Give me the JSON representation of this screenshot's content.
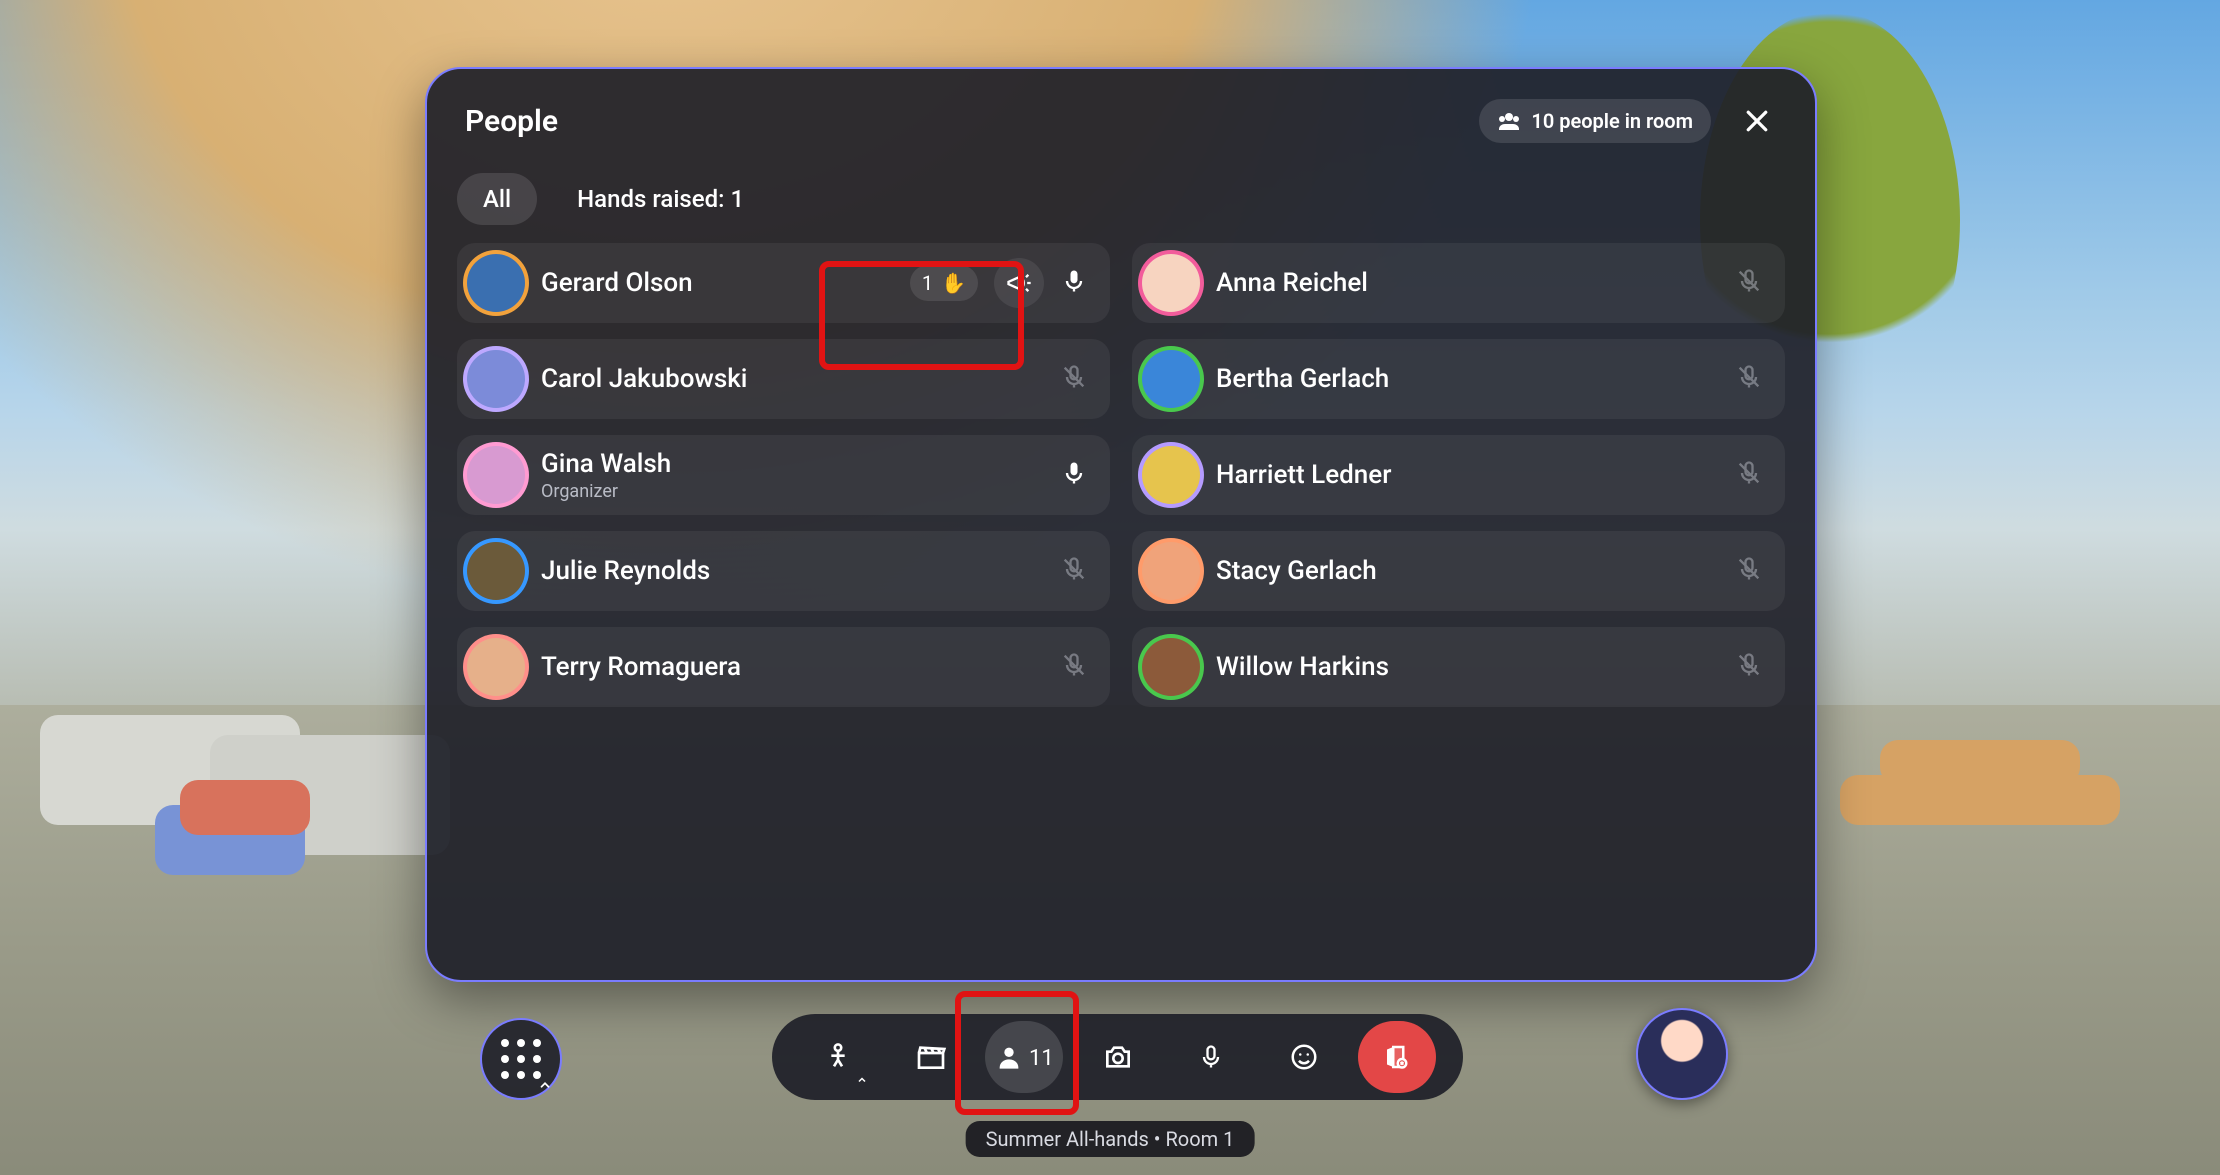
{
  "panel": {
    "title": "People",
    "room_badge": "10 people in room",
    "tabs": {
      "all": "All",
      "raised": "Hands raised: 1"
    }
  },
  "people_left": [
    {
      "name": "Gerard Olson",
      "avatar_ring": "#f2a23c",
      "avatar_bg": "#3a6fb0",
      "hand_order": "1",
      "megaphone": true,
      "mic": "on"
    },
    {
      "name": "Carol Jakubowski",
      "avatar_ring": "#bda8ff",
      "avatar_bg": "#7c8bd9",
      "mic": "muted"
    },
    {
      "name": "Gina Walsh",
      "avatar_ring": "#ff9bd2",
      "avatar_bg": "#d89ad1",
      "role": "Organizer",
      "mic": "on"
    },
    {
      "name": "Julie Reynolds",
      "avatar_ring": "#3698ff",
      "avatar_bg": "#6b5a3a",
      "mic": "muted"
    },
    {
      "name": "Terry Romaguera",
      "avatar_ring": "#ff8f8a",
      "avatar_bg": "#e6b08a",
      "mic": "muted"
    }
  ],
  "people_right": [
    {
      "name": "Anna Reichel",
      "avatar_ring": "#f25c9b",
      "avatar_bg": "#f7d4c0",
      "mic": "muted"
    },
    {
      "name": "Bertha Gerlach",
      "avatar_ring": "#49c84d",
      "avatar_bg": "#3a86d9",
      "mic": "muted"
    },
    {
      "name": "Harriett Ledner",
      "avatar_ring": "#b59bff",
      "avatar_bg": "#e6c44d",
      "mic": "muted"
    },
    {
      "name": "Stacy Gerlach",
      "avatar_ring": "#ff9b6a",
      "avatar_bg": "#f0a37a",
      "mic": "muted"
    },
    {
      "name": "Willow Harkins",
      "avatar_ring": "#49c84d",
      "avatar_bg": "#8c5a3a",
      "mic": "muted"
    }
  ],
  "toolbar": {
    "people_count": "11"
  },
  "caption": "Summer All-hands • Room 1",
  "colors": {
    "annotation": "#e11313",
    "panel_border": "#7a7cff",
    "leave": "#e34747"
  }
}
